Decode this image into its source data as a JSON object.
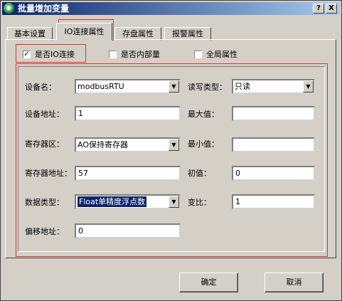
{
  "window": {
    "title": "批量增加变量",
    "help_label": "?",
    "close_label": "X"
  },
  "tabs": [
    {
      "label": "基本设置"
    },
    {
      "label": "IO连接属性"
    },
    {
      "label": "存盘属性"
    },
    {
      "label": "报警属性"
    }
  ],
  "options": {
    "io_connect": {
      "label": "是否IO连接",
      "checked": true,
      "mark": "✓"
    },
    "internal": {
      "label": "是否内部量",
      "checked": false,
      "mark": ""
    },
    "global": {
      "label": "全局属性",
      "checked": false,
      "mark": ""
    }
  },
  "form": {
    "device_name": {
      "label": "设备名：",
      "value": "modbusRTU"
    },
    "device_addr": {
      "label": "设备地址：",
      "value": "1"
    },
    "register_area": {
      "label": "寄存器区：",
      "value": "AO保持寄存器"
    },
    "register_addr": {
      "label": "寄存器地址：",
      "value": "57"
    },
    "data_type": {
      "label": "数据类型：",
      "value": "Float单精度浮点数"
    },
    "offset_addr": {
      "label": "偏移地址：",
      "value": "0"
    },
    "rw_type": {
      "label": "读写类型：",
      "value": "只读"
    },
    "max_value": {
      "label": "最大值：",
      "value": ""
    },
    "min_value": {
      "label": "最小值：",
      "value": ""
    },
    "initial_value": {
      "label": "初值：",
      "value": "0"
    },
    "ratio": {
      "label": "变比：",
      "value": "1"
    }
  },
  "buttons": {
    "ok": "确定",
    "cancel": "取消"
  },
  "icons": {
    "app": "app-icon",
    "dropdown": "chevron-down-icon",
    "check": "checkmark-icon"
  },
  "colors": {
    "title_bar": "#0a246a",
    "highlight": "#e03030",
    "face": "#d4d0c8"
  }
}
